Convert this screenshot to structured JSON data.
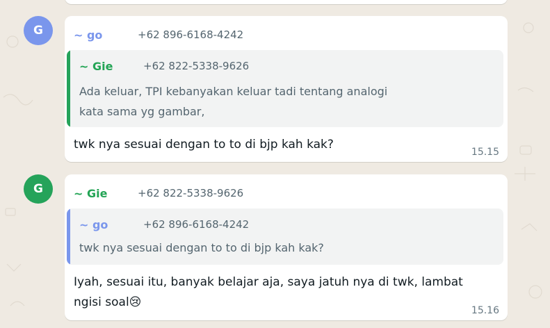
{
  "colors": {
    "background": "#efeae2",
    "bubble": "#ffffff",
    "quote_background": "#f2f3f3",
    "go_color": "#7a96ec",
    "gie_color": "#23a455",
    "gie_quote_bar": "#25a35a",
    "go_quote_bar": "#7a96ec",
    "meta_text": "#54656f"
  },
  "messages": [
    {
      "avatar_letter": "G",
      "sender": "~ go",
      "phone": "+62 896-6168-4242",
      "quoted": {
        "sender": "~ Gie",
        "phone": "+62 822-5338-9626",
        "text_line1": "Ada keluar, TPI kebanyakan keluar tadi tentang analogi",
        "text_line2": "kata sama yg gambar,"
      },
      "text": "twk nya sesuai dengan to to di bjp kah kak?",
      "time": "15.15"
    },
    {
      "avatar_letter": "G",
      "sender": "~ Gie",
      "phone": "+62 822-5338-9626",
      "quoted": {
        "sender": "~ go",
        "phone": "+62 896-6168-4242",
        "text": "twk nya sesuai dengan to to di bjp kah kak?"
      },
      "text_line1": "Iyah, sesuai itu, banyak belajar aja, saya jatuh nya di twk, lambat",
      "text_line2": "ngisi soal",
      "emoji": "😢",
      "time": "15.16"
    }
  ]
}
